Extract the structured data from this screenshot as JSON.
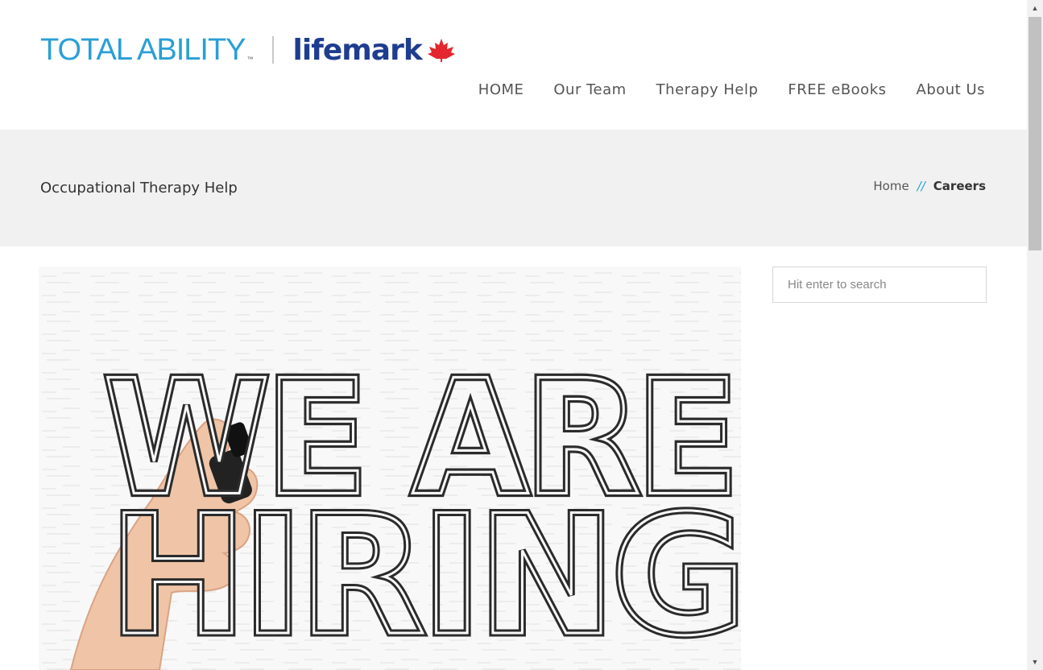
{
  "logo": {
    "brand1": "TOTAL ABILITY",
    "brand1_tm": "™",
    "brand2": "lifemark"
  },
  "nav": {
    "items": [
      {
        "label": "HOME"
      },
      {
        "label": "Our Team"
      },
      {
        "label": "Therapy Help"
      },
      {
        "label": "FREE eBooks"
      },
      {
        "label": "About Us"
      }
    ]
  },
  "titlebar": {
    "title": "Occupational Therapy Help",
    "breadcrumb": {
      "home": "Home",
      "separator": "//",
      "current": "Careers"
    }
  },
  "hero": {
    "line1": "WE ARE",
    "line2": "HIRING"
  },
  "search": {
    "placeholder": "Hit enter to search"
  },
  "colors": {
    "accent": "#2a9fd6",
    "lifemark_blue": "#1f3d8f",
    "leaf_red": "#e3262f",
    "titlebar_bg": "#f1f1f1"
  },
  "icons": {
    "scroll_up": "scroll-up-arrow-icon",
    "scroll_down": "scroll-down-arrow-icon",
    "leaf": "maple-leaf-icon"
  }
}
